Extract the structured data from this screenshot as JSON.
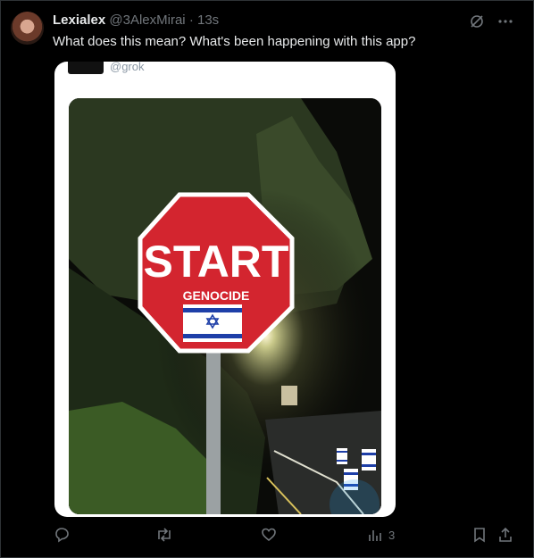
{
  "post": {
    "author_name": "Lexialex",
    "author_handle": "@3AlexMirai",
    "separator": "·",
    "timestamp": "13s",
    "text": "What does this mean? What's been happening with this app?"
  },
  "embedded_card": {
    "handle": "@grok",
    "sign": {
      "main_text": "START",
      "sub_text": "GENOCIDE"
    }
  },
  "actions": {
    "views_count": "3"
  },
  "icons": [
    "avatar",
    "grok-icon",
    "more-icon",
    "reply-icon",
    "repost-icon",
    "like-icon",
    "views-icon",
    "bookmark-icon",
    "share-icon"
  ]
}
